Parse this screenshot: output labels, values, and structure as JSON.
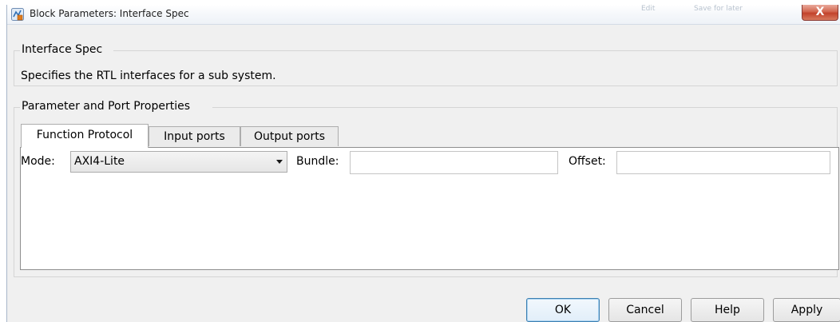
{
  "window": {
    "title": "Block Parameters: Interface Spec",
    "ghost_toolbar": [
      "Edit",
      "Save for later"
    ],
    "close_glyph": "X",
    "icon": "simulink-block-icon"
  },
  "block": {
    "name": "Interface Spec",
    "description": "Specifies the RTL interfaces for a sub system."
  },
  "section": {
    "title": "Parameter and Port Properties"
  },
  "tabs": [
    {
      "label": "Function Protocol",
      "active": true
    },
    {
      "label": "Input ports",
      "active": false
    },
    {
      "label": "Output ports",
      "active": false
    }
  ],
  "fields": {
    "mode_label": "Mode:",
    "mode_value": "AXI4-Lite",
    "bundle_label": "Bundle:",
    "bundle_value": "",
    "offset_label": "Offset:",
    "offset_value": ""
  },
  "buttons": {
    "ok": "OK",
    "cancel": "Cancel",
    "help": "Help",
    "apply": "Apply"
  },
  "colors": {
    "dialog_bg": "#f0f0f0",
    "close_button": "#c7503a",
    "default_button_border": "#3c7fb1"
  }
}
